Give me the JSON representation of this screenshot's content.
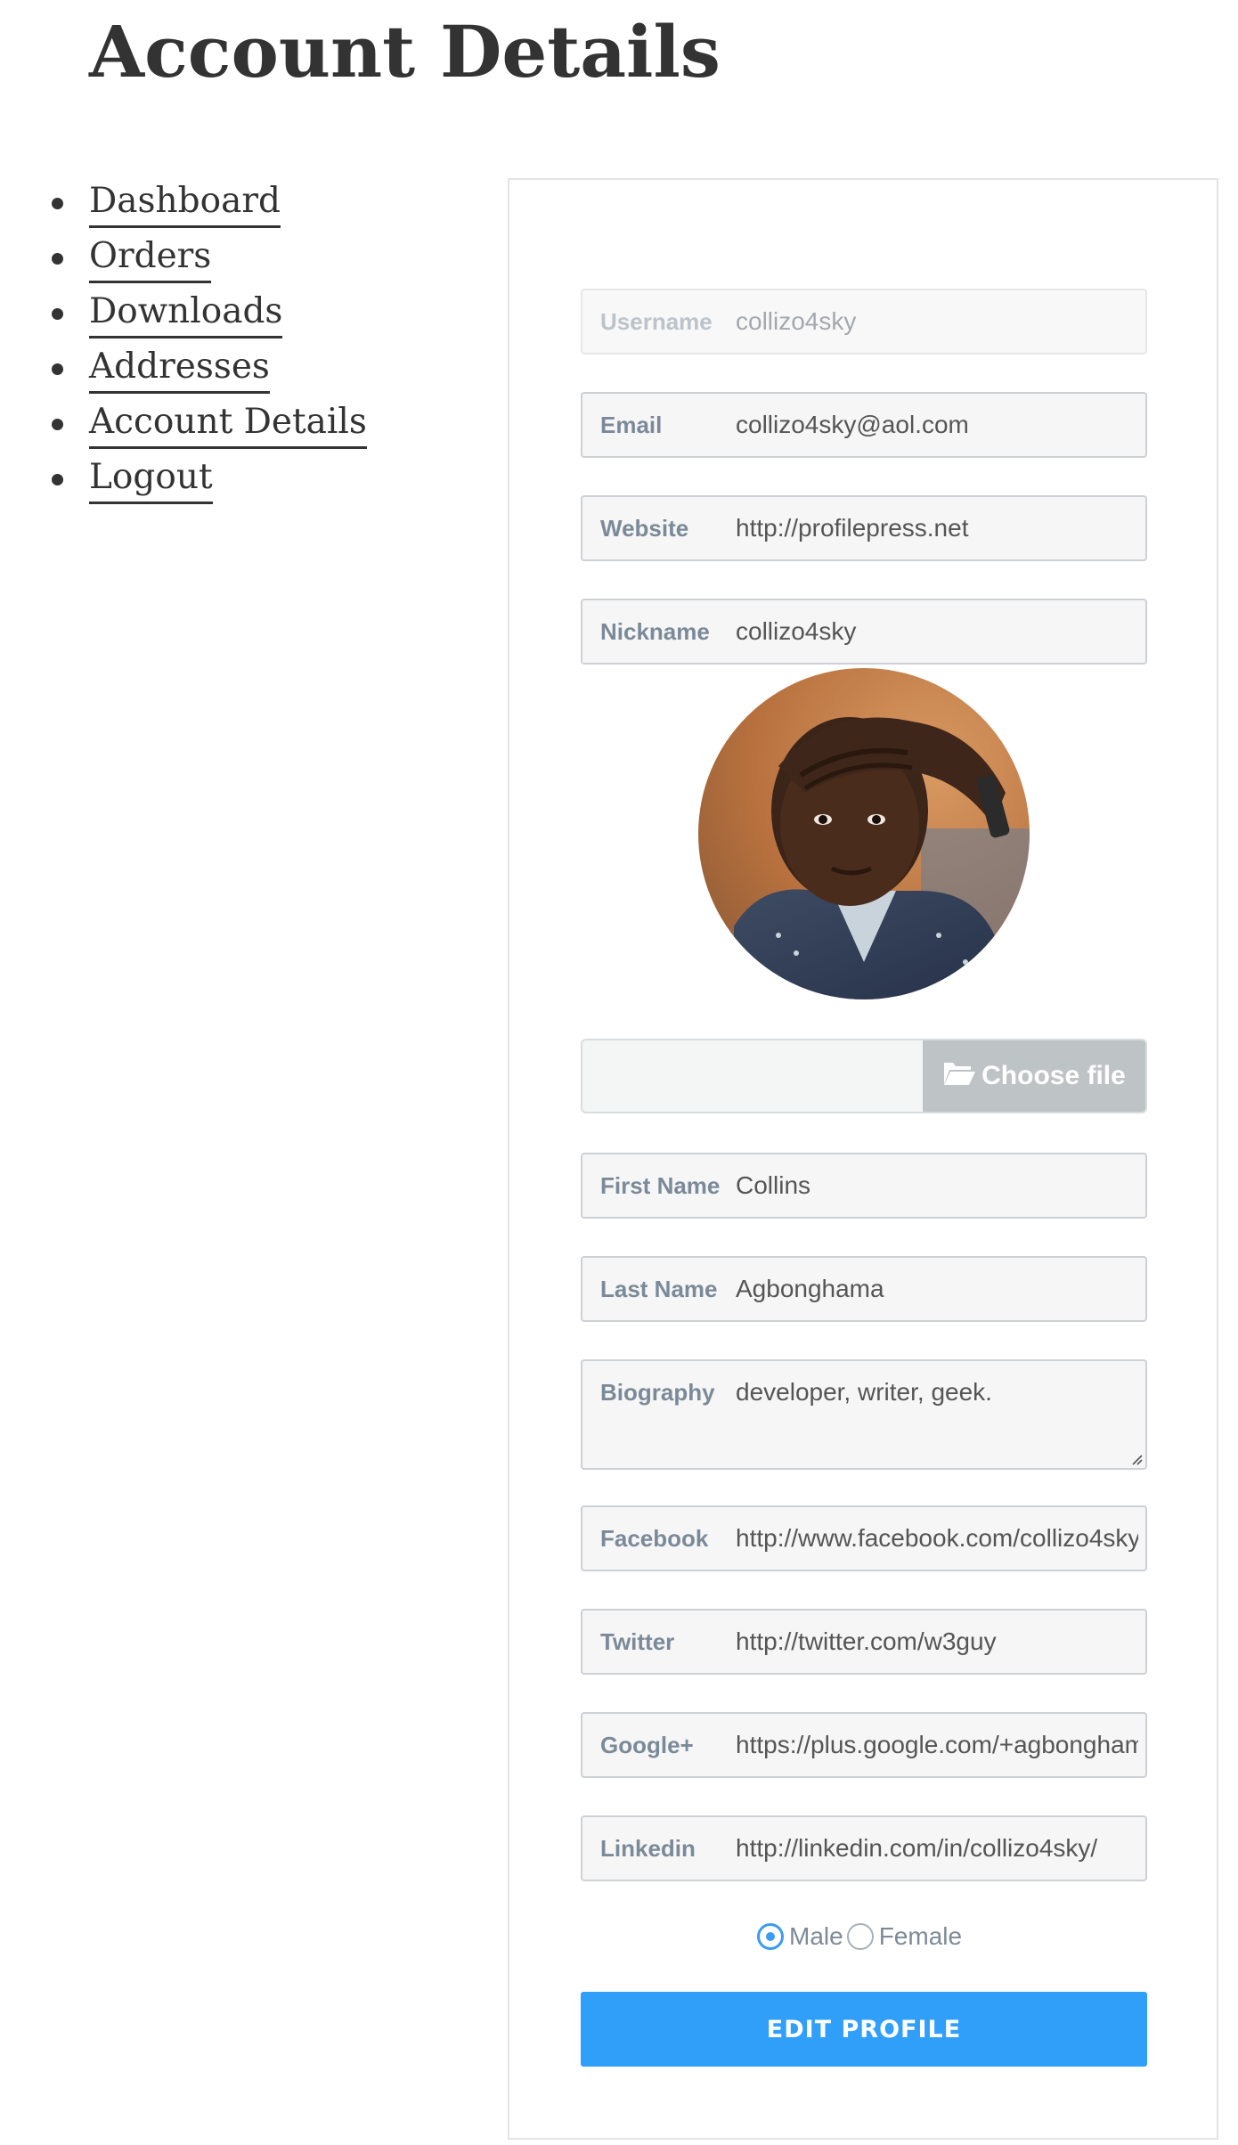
{
  "page": {
    "title": "Account Details"
  },
  "nav": {
    "items": [
      {
        "label": "Dashboard"
      },
      {
        "label": "Orders"
      },
      {
        "label": "Downloads"
      },
      {
        "label": "Addresses"
      },
      {
        "label": "Account Details"
      },
      {
        "label": "Logout"
      }
    ]
  },
  "form": {
    "username": {
      "label": "Username",
      "value": "collizo4sky"
    },
    "email": {
      "label": "Email",
      "value": "collizo4sky@aol.com"
    },
    "website": {
      "label": "Website",
      "value": "http://profilepress.net"
    },
    "nickname": {
      "label": "Nickname",
      "value": "collizo4sky"
    },
    "file": {
      "button_label": "Choose file",
      "icon": "folder-open-icon"
    },
    "first_name": {
      "label": "First Name",
      "value": "Collins"
    },
    "last_name": {
      "label": "Last Name",
      "value": "Agbonghama"
    },
    "biography": {
      "label": "Biography",
      "value": "developer, writer, geek."
    },
    "facebook": {
      "label": "Facebook",
      "value": "http://www.facebook.com/collizo4sky"
    },
    "twitter": {
      "label": "Twitter",
      "value": "http://twitter.com/w3guy"
    },
    "google": {
      "label": "Google+",
      "value": "https://plus.google.com/+agbonghama"
    },
    "linkedin": {
      "label": "Linkedin",
      "value": "http://linkedin.com/in/collizo4sky/"
    },
    "gender": {
      "options": [
        {
          "label": "Male"
        },
        {
          "label": "Female"
        }
      ],
      "selected": "Male"
    },
    "submit_label": "EDIT PROFILE"
  },
  "colors": {
    "accent": "#2f9ffa",
    "text": "#333333",
    "field_label": "#7b8a99",
    "field_bg": "#f6f6f6"
  }
}
